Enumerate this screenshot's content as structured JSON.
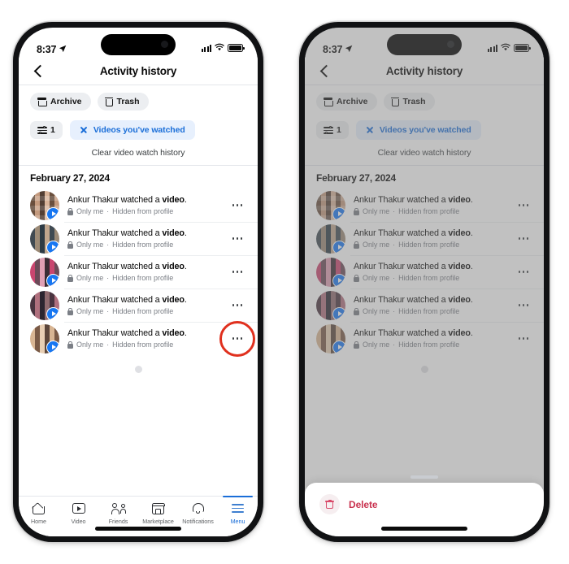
{
  "status_bar": {
    "time": "8:37",
    "location_arrow_icon": "location-arrow-icon",
    "signal_icon": "cellular-signal-icon",
    "wifi_icon": "wifi-icon",
    "battery_icon": "battery-full-icon"
  },
  "header": {
    "back_icon": "chevron-left-icon",
    "title": "Activity history"
  },
  "chips": [
    {
      "label": "Archive",
      "icon": "archive-box-icon"
    },
    {
      "label": "Trash",
      "icon": "trash-can-icon"
    }
  ],
  "filters": {
    "count": "1",
    "sliders_icon": "filter-sliders-icon",
    "active_filter": "Videos you've watched",
    "remove_icon": "close-x-icon"
  },
  "clear_link": "Clear video watch history",
  "date_header": "February 27, 2024",
  "rows": [
    {
      "title_prefix": "Ankur Thakur watched a ",
      "title_bold": "video",
      "title_suffix": ".",
      "privacy": "Only me",
      "separator": "·",
      "visibility": "Hidden from profile",
      "lock_icon": "lock-icon",
      "badge_icon": "video-play-badge-icon",
      "overflow_icon": "more-options-icon"
    },
    {
      "title_prefix": "Ankur Thakur watched a ",
      "title_bold": "video",
      "title_suffix": ".",
      "privacy": "Only me",
      "separator": "·",
      "visibility": "Hidden from profile",
      "lock_icon": "lock-icon",
      "badge_icon": "video-play-badge-icon",
      "overflow_icon": "more-options-icon"
    },
    {
      "title_prefix": "Ankur Thakur watched a ",
      "title_bold": "video",
      "title_suffix": ".",
      "privacy": "Only me",
      "separator": "·",
      "visibility": "Hidden from profile",
      "lock_icon": "lock-icon",
      "badge_icon": "video-play-badge-icon",
      "overflow_icon": "more-options-icon"
    },
    {
      "title_prefix": "Ankur Thakur watched a ",
      "title_bold": "video",
      "title_suffix": ".",
      "privacy": "Only me",
      "separator": "·",
      "visibility": "Hidden from profile",
      "lock_icon": "lock-icon",
      "badge_icon": "video-play-badge-icon",
      "overflow_icon": "more-options-icon"
    },
    {
      "title_prefix": "Ankur Thakur watched a ",
      "title_bold": "video",
      "title_suffix": ".",
      "privacy": "Only me",
      "separator": "·",
      "visibility": "Hidden from profile",
      "lock_icon": "lock-icon",
      "badge_icon": "video-play-badge-icon",
      "overflow_icon": "more-options-icon",
      "highlighted": true
    }
  ],
  "tabbar": [
    {
      "label": "Home",
      "icon": "home-icon",
      "active": false
    },
    {
      "label": "Video",
      "icon": "video-icon",
      "active": false
    },
    {
      "label": "Friends",
      "icon": "friends-icon",
      "active": false
    },
    {
      "label": "Marketplace",
      "icon": "marketplace-icon",
      "active": false
    },
    {
      "label": "Notifications",
      "icon": "bell-icon",
      "active": false
    },
    {
      "label": "Menu",
      "icon": "hamburger-menu-icon",
      "active": true
    }
  ],
  "sheet": {
    "grabber_icon": "sheet-grabber-icon",
    "delete_label": "Delete",
    "delete_icon": "trash-can-icon"
  },
  "annotation": {
    "highlight_icon": "red-highlight-circle",
    "color": "#e0301e"
  },
  "colors": {
    "accent_blue": "#1a6ed8",
    "filter_pill_bg": "#e7f0fd",
    "chip_bg": "#eceef1",
    "delete_red": "#c9324f",
    "badge_blue": "#1877f2"
  }
}
